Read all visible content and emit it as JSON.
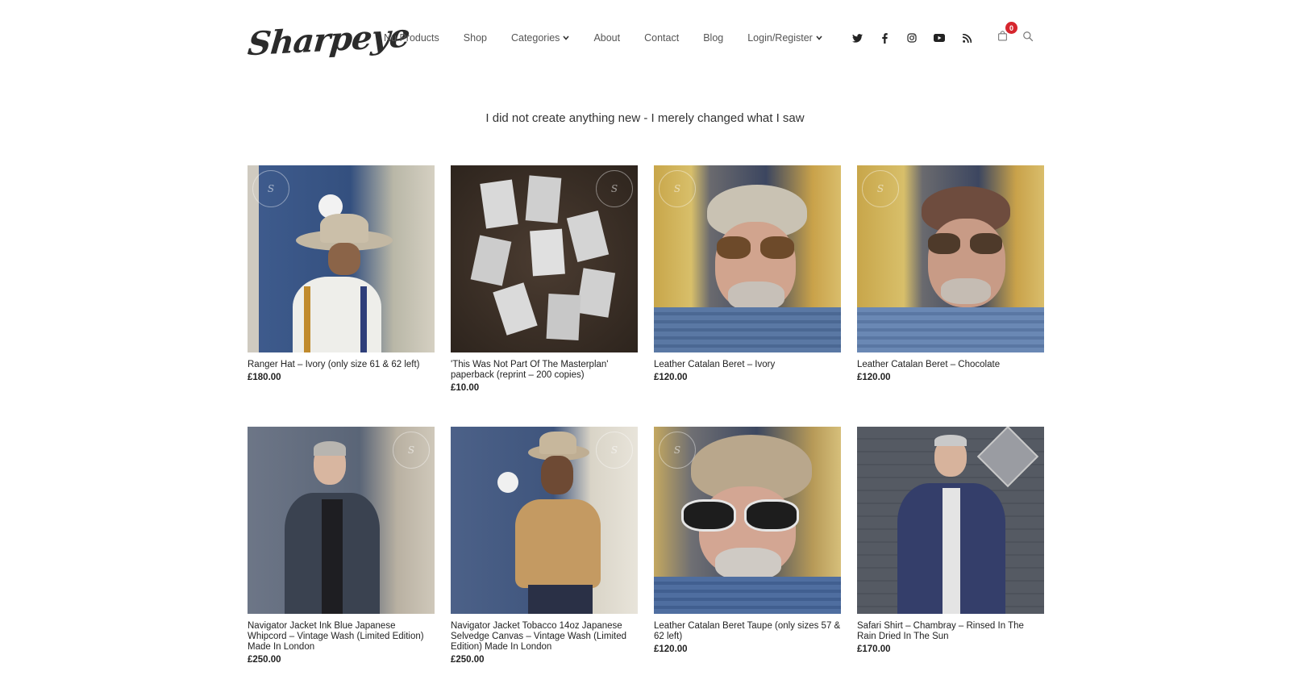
{
  "header": {
    "logo_text": "Sharpeye",
    "nav": [
      {
        "label": "Nu Products",
        "has_dropdown": false
      },
      {
        "label": "Shop",
        "has_dropdown": false
      },
      {
        "label": "Categories",
        "has_dropdown": true
      },
      {
        "label": "About",
        "has_dropdown": false
      },
      {
        "label": "Contact",
        "has_dropdown": false
      },
      {
        "label": "Blog",
        "has_dropdown": false
      },
      {
        "label": "Login/Register",
        "has_dropdown": true
      }
    ],
    "social_icons": [
      "twitter-icon",
      "facebook-icon",
      "instagram-icon",
      "youtube-icon",
      "rss-icon"
    ],
    "cart_count": "0"
  },
  "tagline": "I did not create anything new - I merely changed what I saw",
  "products": [
    {
      "name": "Ranger Hat – Ivory (only size 61 & 62 left)",
      "price": "£180.00"
    },
    {
      "name": "'This Was Not Part Of The Masterplan' paperback (reprint – 200 copies)",
      "price": "£10.00"
    },
    {
      "name": "Leather Catalan Beret – Ivory",
      "price": "£120.00"
    },
    {
      "name": "Leather Catalan Beret – Chocolate",
      "price": "£120.00"
    },
    {
      "name": "Navigator Jacket Ink Blue Japanese Whipcord – Vintage Wash (Limited Edition) Made In London",
      "price": "£250.00"
    },
    {
      "name": "Navigator Jacket Tobacco 14oz Japanese Selvedge Canvas – Vintage Wash (Limited Edition) Made In London",
      "price": "£250.00"
    },
    {
      "name": "Leather Catalan Beret Taupe (only sizes 57 & 62 left)",
      "price": "£120.00"
    },
    {
      "name": "Safari Shirt – Chambray – Rinsed In The Rain Dried In The Sun",
      "price": "£170.00"
    }
  ],
  "colors": {
    "badge": "#d6262e",
    "text": "#222222",
    "nav_text": "#555555"
  }
}
